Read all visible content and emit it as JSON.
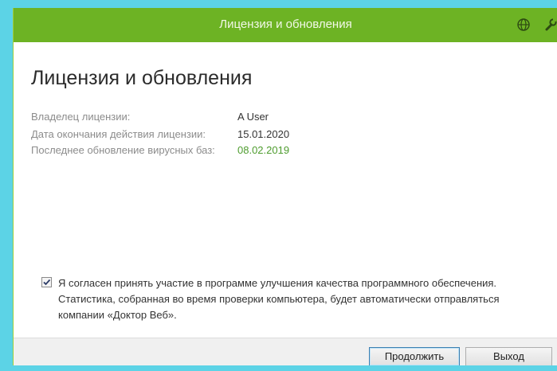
{
  "window": {
    "title": "Лицензия и обновления"
  },
  "titlebar_icons": [
    "globe-icon",
    "wrench-icon"
  ],
  "page": {
    "heading": "Лицензия и обновления"
  },
  "license": {
    "owner_label": "Владелец лицензии:",
    "owner_value": "A User",
    "expiry_label": "Дата окончания действия лицензии:",
    "expiry_value": "15.01.2020",
    "update_label": "Последнее обновление вирусных баз:",
    "update_value": "08.02.2019"
  },
  "agreement": {
    "checked": true,
    "text": "Я согласен принять участие в программе улучшения качества программного обеспечения. Статистика, собранная во время проверки компьютера, будет автоматически отправляться компании «Доктор Веб»."
  },
  "buttons": {
    "continue_label": "Продолжить",
    "exit_label": "Выход"
  },
  "colors": {
    "titlebar": "#6db324",
    "accent_green_text": "#4e9c2e",
    "backdrop": "#5cd3e6"
  }
}
